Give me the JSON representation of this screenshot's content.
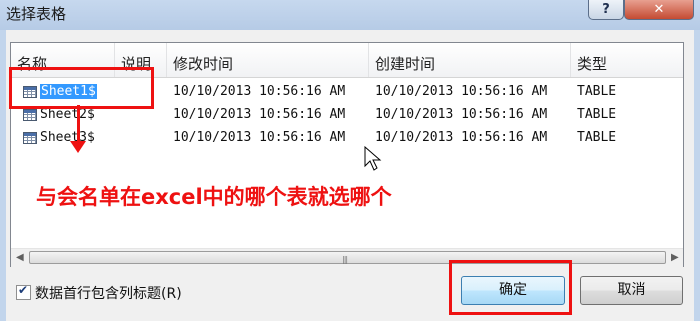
{
  "window": {
    "title": "选择表格",
    "help_label": "?",
    "close_label": "✕"
  },
  "table": {
    "columns": [
      "名称",
      "说明",
      "修改时间",
      "创建时间",
      "类型"
    ],
    "rows": [
      {
        "name": "Sheet1$",
        "description": "",
        "modified": "10/10/2013 10:56:16 AM",
        "created": "10/10/2013 10:56:16 AM",
        "type": "TABLE"
      },
      {
        "name": "Sheet2$",
        "description": "",
        "modified": "10/10/2013 10:56:16 AM",
        "created": "10/10/2013 10:56:16 AM",
        "type": "TABLE"
      },
      {
        "name": "Sheet3$",
        "description": "",
        "modified": "10/10/2013 10:56:16 AM",
        "created": "10/10/2013 10:56:16 AM",
        "type": "TABLE"
      }
    ],
    "selected_row": 0
  },
  "scrollbar": {
    "left_arrow": "◀",
    "right_arrow": "▶",
    "grip": "|||"
  },
  "options": {
    "first_row_headers_label": "数据首行包含列标题(R)",
    "first_row_headers_checked": true
  },
  "buttons": {
    "ok_label": "确定",
    "cancel_label": "取消"
  },
  "annotation": {
    "text": "与会名单在excel中的哪个表就选哪个",
    "color": "#ee1111"
  },
  "colors": {
    "selection": "#3399ff",
    "annotation": "#ee1111"
  }
}
